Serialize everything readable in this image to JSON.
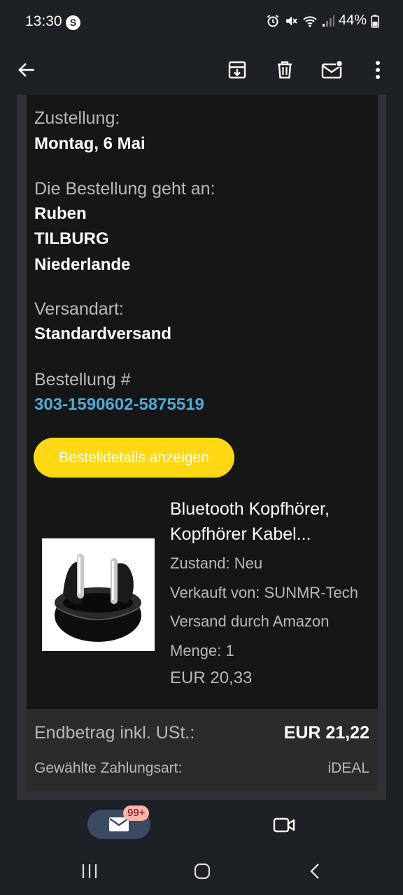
{
  "status_bar": {
    "time": "13:30",
    "battery": "44%"
  },
  "delivery": {
    "label": "Zustellung:",
    "value": "Montag, 6 Mai"
  },
  "recipient": {
    "label": "Die Bestellung geht an:",
    "name": "Ruben",
    "city": "TILBURG",
    "country": "Niederlande"
  },
  "shipping": {
    "label": "Versandart:",
    "value": "Standardversand"
  },
  "order": {
    "label": "Bestellung #",
    "number": "303-1590602-5875519",
    "details_button": "Bestelldetails anzeigen"
  },
  "product": {
    "title_line1": "Bluetooth Kopfhörer,",
    "title_line2": "Kopfhörer Kabel...",
    "condition": "Zustand: Neu",
    "seller": "Verkauft von: SUNMR-Tech",
    "fulfillment": "Versand durch Amazon",
    "quantity": "Menge: 1",
    "price": "EUR 20,33",
    "image_icon": "earbuds-product-image"
  },
  "summary": {
    "total_label": "Endbetrag inkl. USt.:",
    "total_value": "EUR 21,22",
    "payment_label": "Gewählte Zahlungsart:",
    "payment_value": "iDEAL"
  },
  "bottom_nav": {
    "mail_badge": "99+"
  },
  "colors": {
    "background": "#1d2024",
    "card": "#161616",
    "accent_button": "#fed813",
    "link": "#4fa9d6",
    "badge": "#ffb4ab"
  }
}
